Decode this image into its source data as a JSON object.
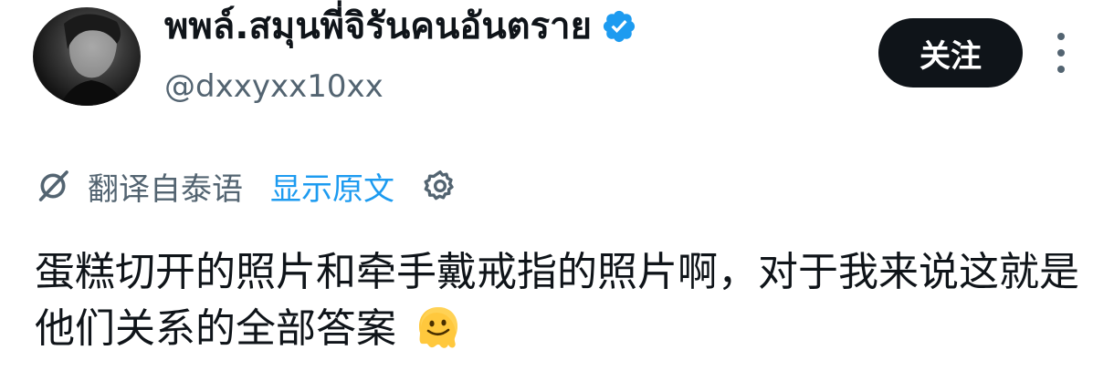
{
  "profile": {
    "display_name": "พพล์.สมุนพี่จิรันคนอันตราย",
    "handle": "@dxxyxx10xx",
    "verified": true,
    "verified_color": "#1d9bf0"
  },
  "actions": {
    "follow_label": "关注",
    "more_icon": "more-vertical-icon"
  },
  "translation": {
    "icon": "translate-off-icon",
    "label": "翻译自泰语",
    "show_original_label": "显示原文",
    "settings_icon": "gear-icon"
  },
  "tweet": {
    "text": "蛋糕切开的照片和牵手戴戒指的照片啊，对于我来说这就是他们关系的全部答案",
    "emoji": "melting-face-emoji"
  },
  "colors": {
    "text": "#0f1419",
    "secondary": "#536471",
    "link": "#1d9bf0",
    "button_bg": "#0f1419"
  }
}
